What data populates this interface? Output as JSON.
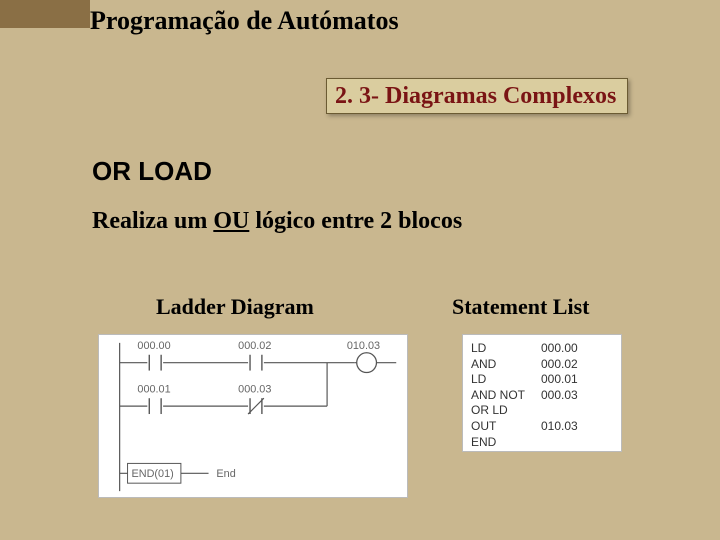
{
  "header": {
    "title": "Programação de Autómatos"
  },
  "section": {
    "label": "2. 3- Diagramas Complexos"
  },
  "subheading": {
    "text": "OR LOAD"
  },
  "description": {
    "pre": "Realiza um ",
    "underlined": "OU",
    "post": " lógico entre 2 blocos"
  },
  "columns": {
    "left": "Ladder Diagram",
    "right": "Statement List"
  },
  "ladder": {
    "contacts": {
      "c1": "000.00",
      "c2": "000.02",
      "c3": "000.01",
      "c4": "000.03",
      "out": "010.03"
    },
    "end_block": "END(01)",
    "end_label": "End"
  },
  "statements": [
    {
      "op": "LD",
      "arg": "000.00"
    },
    {
      "op": "AND",
      "arg": "000.02"
    },
    {
      "op": "LD",
      "arg": "000.01"
    },
    {
      "op": "AND NOT",
      "arg": "000.03"
    },
    {
      "op": "OR LD",
      "arg": ""
    },
    {
      "op": "OUT",
      "arg": "010.03"
    },
    {
      "op": "END",
      "arg": ""
    }
  ]
}
